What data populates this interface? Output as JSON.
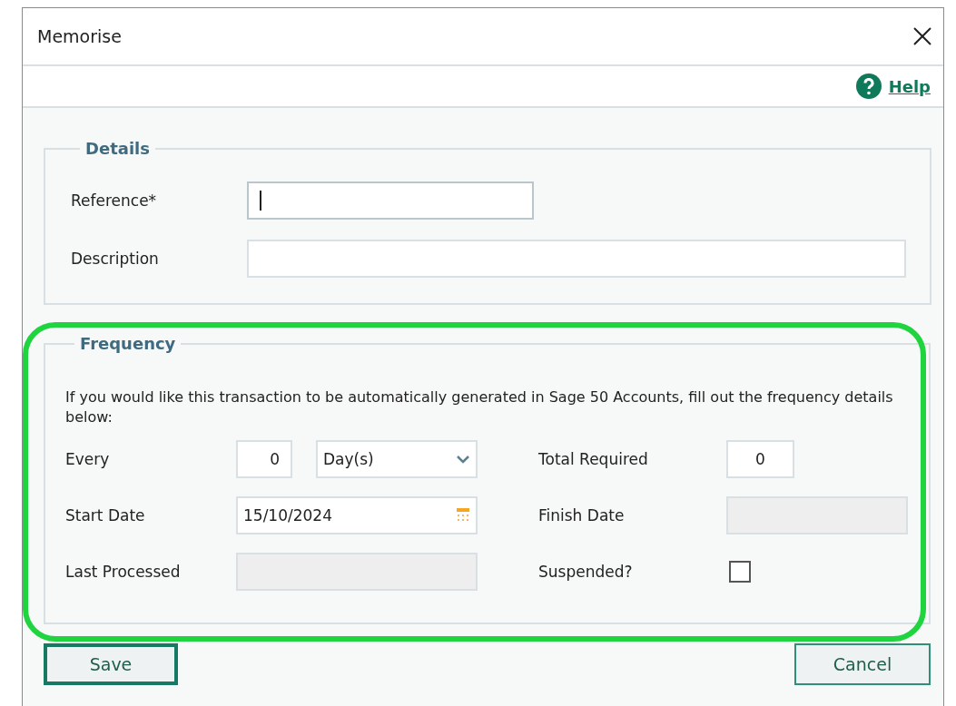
{
  "window": {
    "title": "Memorise"
  },
  "help_link": "Help",
  "details": {
    "title": "Details",
    "fields": [
      {
        "label": "Reference*",
        "focused": true
      },
      {
        "label": "Description",
        "focused": false
      }
    ]
  },
  "frequency": {
    "title": "Frequency",
    "intro": "If you would like this transaction to be automatically generated in Sage 50 Accounts, fill out the frequency details below:",
    "left": [
      {
        "kind": "number_unit",
        "label": "Every",
        "value": "0",
        "unit": "Day(s)"
      },
      {
        "kind": "date",
        "label": "Start Date",
        "value": "15/10/2024"
      },
      {
        "kind": "disabled",
        "label": "Last Processed"
      }
    ],
    "right": [
      {
        "kind": "number",
        "label": "Total Required",
        "value": "0"
      },
      {
        "kind": "disabled",
        "label": "Finish Date"
      },
      {
        "kind": "checkbox",
        "label": "Suspended?",
        "checked": false
      }
    ]
  },
  "buttons": [
    {
      "label": "Save",
      "default": true
    },
    {
      "label": "Cancel",
      "default": false
    }
  ]
}
